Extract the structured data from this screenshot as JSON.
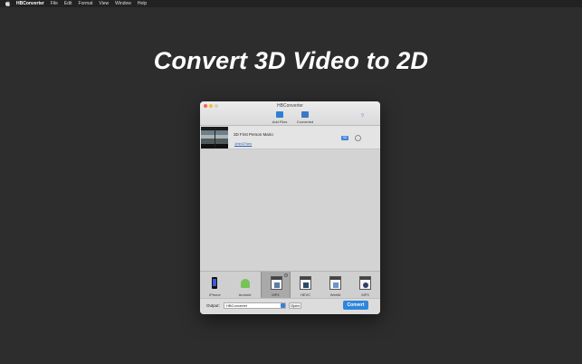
{
  "menubar": {
    "app_name": "HBConverter",
    "items": [
      "File",
      "Edit",
      "Format",
      "View",
      "Window",
      "Help"
    ]
  },
  "headline": "Convert 3D Video to 2D",
  "window": {
    "title": "HBConverter",
    "toolbar": {
      "add_files_label": "Add Files",
      "converted_label": "Converted",
      "help_label": "?"
    },
    "files": [
      {
        "name": "3D First Person Mario",
        "duration": "1min27sec",
        "badge": "3D"
      }
    ],
    "formats": [
      {
        "label": "iPhone",
        "icon": "iphone-icon"
      },
      {
        "label": "Android",
        "icon": "android-icon"
      },
      {
        "label": "MP4",
        "icon": "mp4-file-icon",
        "selected": true
      },
      {
        "label": "HEVC",
        "icon": "hevc-file-icon"
      },
      {
        "label": "WebM",
        "icon": "webm-file-icon"
      },
      {
        "label": "MP3",
        "icon": "mp3-file-icon"
      }
    ],
    "output": {
      "label": "Output:",
      "value": "HBConverter",
      "open_label": "Open",
      "convert_label": "Convert"
    }
  },
  "colors": {
    "background": "#2d2d2d",
    "accent": "#2f86db"
  }
}
